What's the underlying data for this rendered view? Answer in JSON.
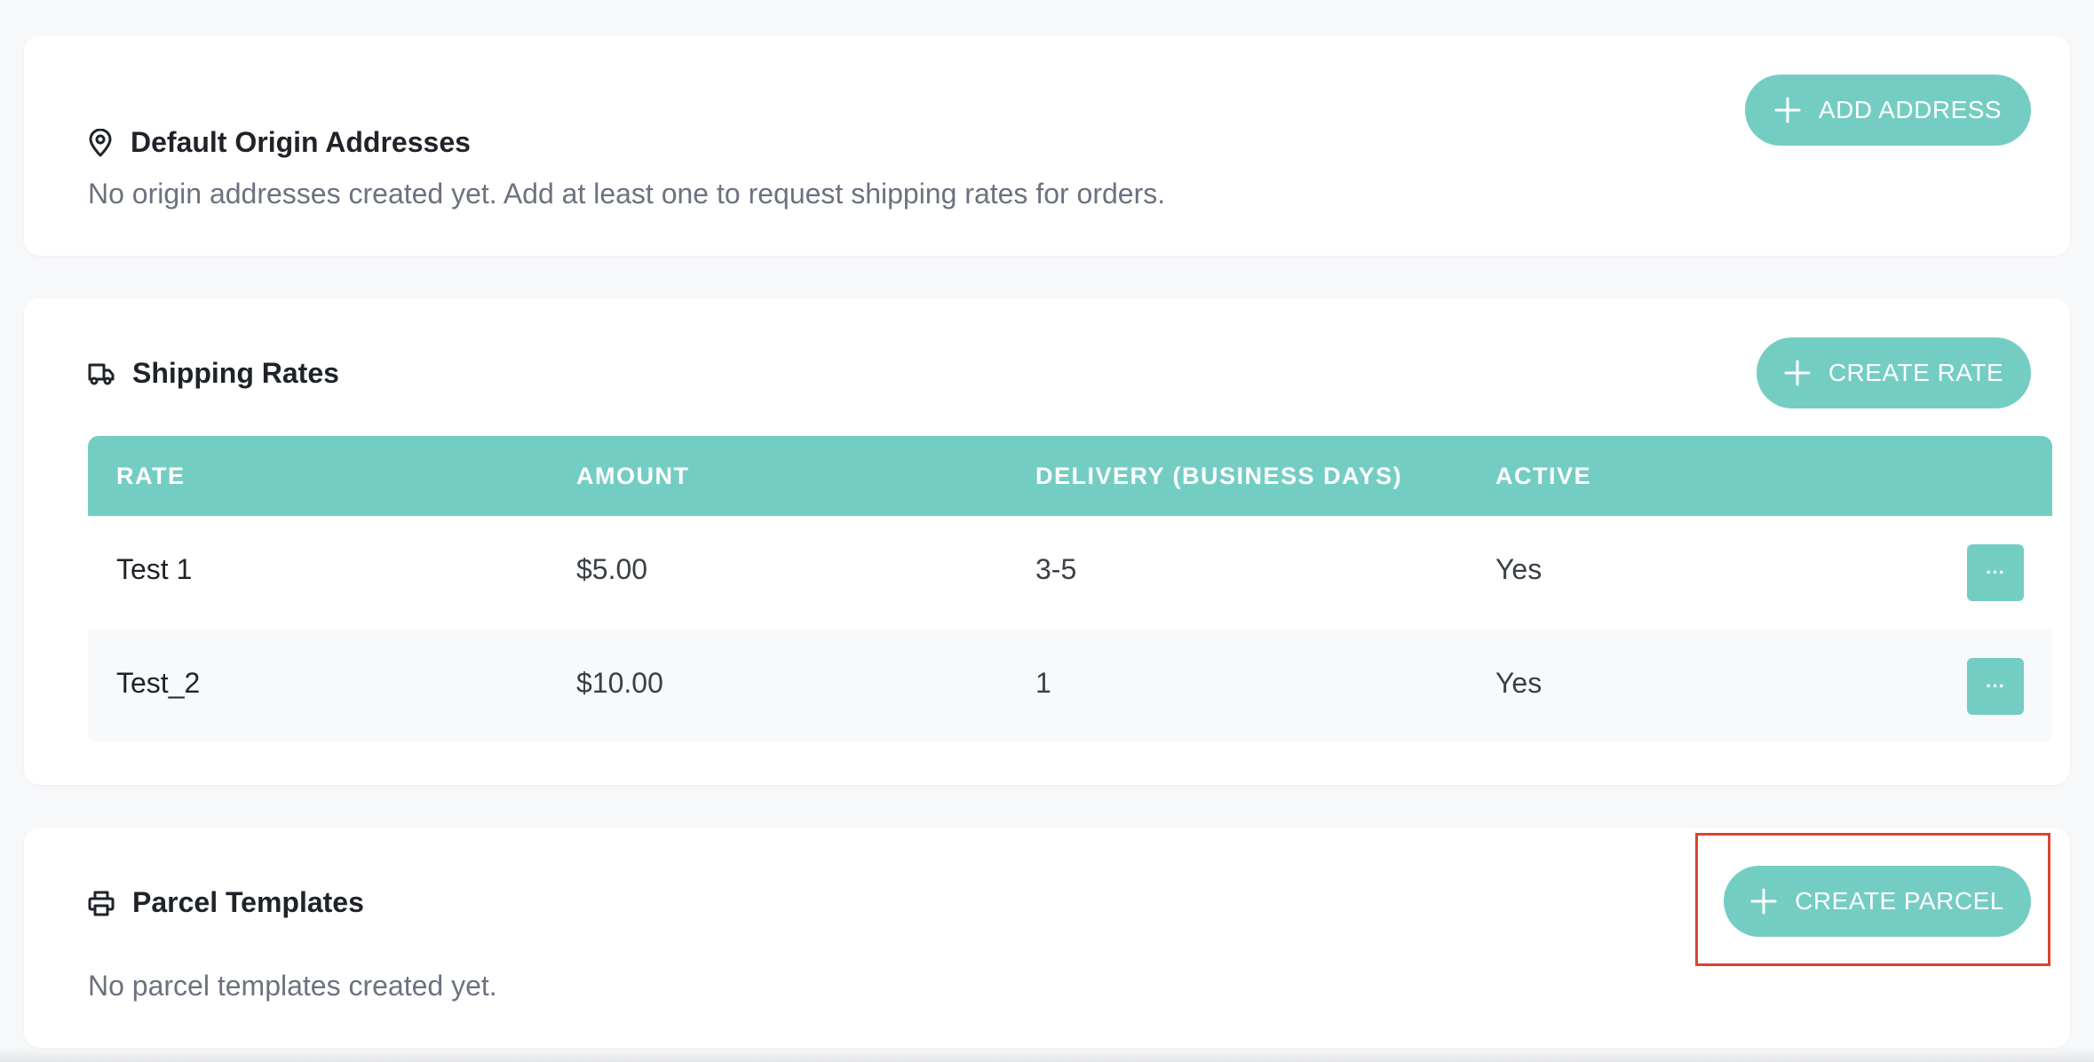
{
  "origin_section": {
    "title": "Default Origin Addresses",
    "icon": "map-pin-icon",
    "add_button_label": "ADD ADDRESS",
    "empty_message": "No origin addresses created yet. Add at least one to request shipping rates for orders."
  },
  "rates_section": {
    "title": "Shipping Rates",
    "icon": "truck-icon",
    "create_button_label": "CREATE RATE",
    "columns": [
      "RATE",
      "AMOUNT",
      "DELIVERY (BUSINESS DAYS)",
      "ACTIVE"
    ],
    "rows": [
      {
        "rate": "Test 1",
        "amount": "$5.00",
        "delivery": "3-5",
        "active": "Yes",
        "actions_label": "···"
      },
      {
        "rate": "Test_2",
        "amount": "$10.00",
        "delivery": "1",
        "active": "Yes",
        "actions_label": "···"
      }
    ]
  },
  "parcel_section": {
    "title": "Parcel Templates",
    "icon": "printer-icon",
    "create_button_label": "CREATE PARCEL",
    "empty_message": "No parcel templates created yet."
  },
  "colors": {
    "accent": "#74cdc2",
    "page_background": "#f7f8fa",
    "highlight": "#d9452f",
    "muted_text": "#6b7280"
  }
}
